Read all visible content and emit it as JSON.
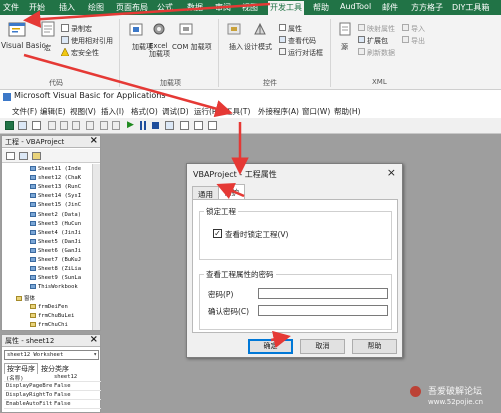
{
  "ribbon": {
    "tabs": [
      "文件",
      "开始",
      "插入",
      "绘图",
      "页面布局",
      "公式",
      "数据",
      "审阅",
      "视图",
      "开发工具",
      "帮助",
      "AudTool",
      "邮件",
      "方方格子",
      "DIY工具箱"
    ],
    "active_tab": "开发工具",
    "code_group": {
      "label": "代码",
      "visual_basic": "Visual Basic",
      "macros": "宏",
      "record_macro": "录制宏",
      "relative_ref": "使用相对引用",
      "macro_security": "宏安全性"
    },
    "addins_group": {
      "label": "加载项",
      "addins": "加载项",
      "excel_addins": "Excel 加载项",
      "com_addins": "COM 加载项"
    },
    "controls_group": {
      "label": "控件",
      "insert": "插入",
      "design_mode": "设计模式",
      "properties": "属性",
      "view_code": "查看代码",
      "run_dialog": "运行对话框"
    },
    "xml_group": {
      "label": "XML",
      "source": "源",
      "map_properties": "映射属性",
      "expansion_packs": "扩展包",
      "refresh_data": "刷新数据",
      "import": "导入",
      "export": "导出"
    }
  },
  "vbe": {
    "title": "Microsoft Visual Basic for Applications",
    "menu": [
      "文件(F)",
      "编辑(E)",
      "视图(V)",
      "插入(I)",
      "格式(O)",
      "调试(D)",
      "运行(R)",
      "工具(T)",
      "外接程序(A)",
      "窗口(W)",
      "帮助(H)"
    ],
    "project_panel": {
      "title": "工程 - VBAProject",
      "items": [
        "Sheet11 (Inde",
        "sheet12 (ChaK",
        "Sheet13 (RunC",
        "Sheet14 (SysI",
        "Sheet15 (JinC",
        "Sheet2 (Data)",
        "Sheet3 (HuCun",
        "Sheet4 (JinJi",
        "Sheet5 (DanJi",
        "Sheet6 (GanJi",
        "Sheet7 (BuKuJ",
        "Sheet8 (ZiLia",
        "Sheet9 (SunLa",
        "ThisWorkbook",
        "窗体",
        "frmDeiFen",
        "frmChuBuLei",
        "frmChuChi"
      ]
    },
    "properties_panel": {
      "title": "属性 - sheet12",
      "selected_object": "sheet12 Worksheet",
      "tabs": [
        "按字母序",
        "按分类序"
      ],
      "rows": [
        {
          "name": "(名称)",
          "value": "sheet12"
        },
        {
          "name": "DisplayPageBre",
          "value": "False"
        },
        {
          "name": "DisplayRightTo",
          "value": "False"
        },
        {
          "name": "EnableAutoFilt",
          "value": "False"
        }
      ]
    }
  },
  "dialog": {
    "title": "VBAProject - 工程属性",
    "tabs": [
      "通用",
      "保护"
    ],
    "active_tab": "保护",
    "lock_group_title": "锁定工程",
    "lock_checkbox_label": "查看时锁定工程(V)",
    "lock_checked": true,
    "password_group_title": "查看工程属性的密码",
    "password_label": "密码(P)",
    "confirm_label": "确认密码(C)",
    "buttons": {
      "ok": "确定",
      "cancel": "取消",
      "help": "帮助"
    }
  },
  "watermark": {
    "name": "吾爱破解论坛",
    "url": "www.52pojie.cn"
  },
  "colors": {
    "excel_green": "#217346",
    "arrow_red": "#e53935",
    "accent_blue": "#0078d7"
  }
}
